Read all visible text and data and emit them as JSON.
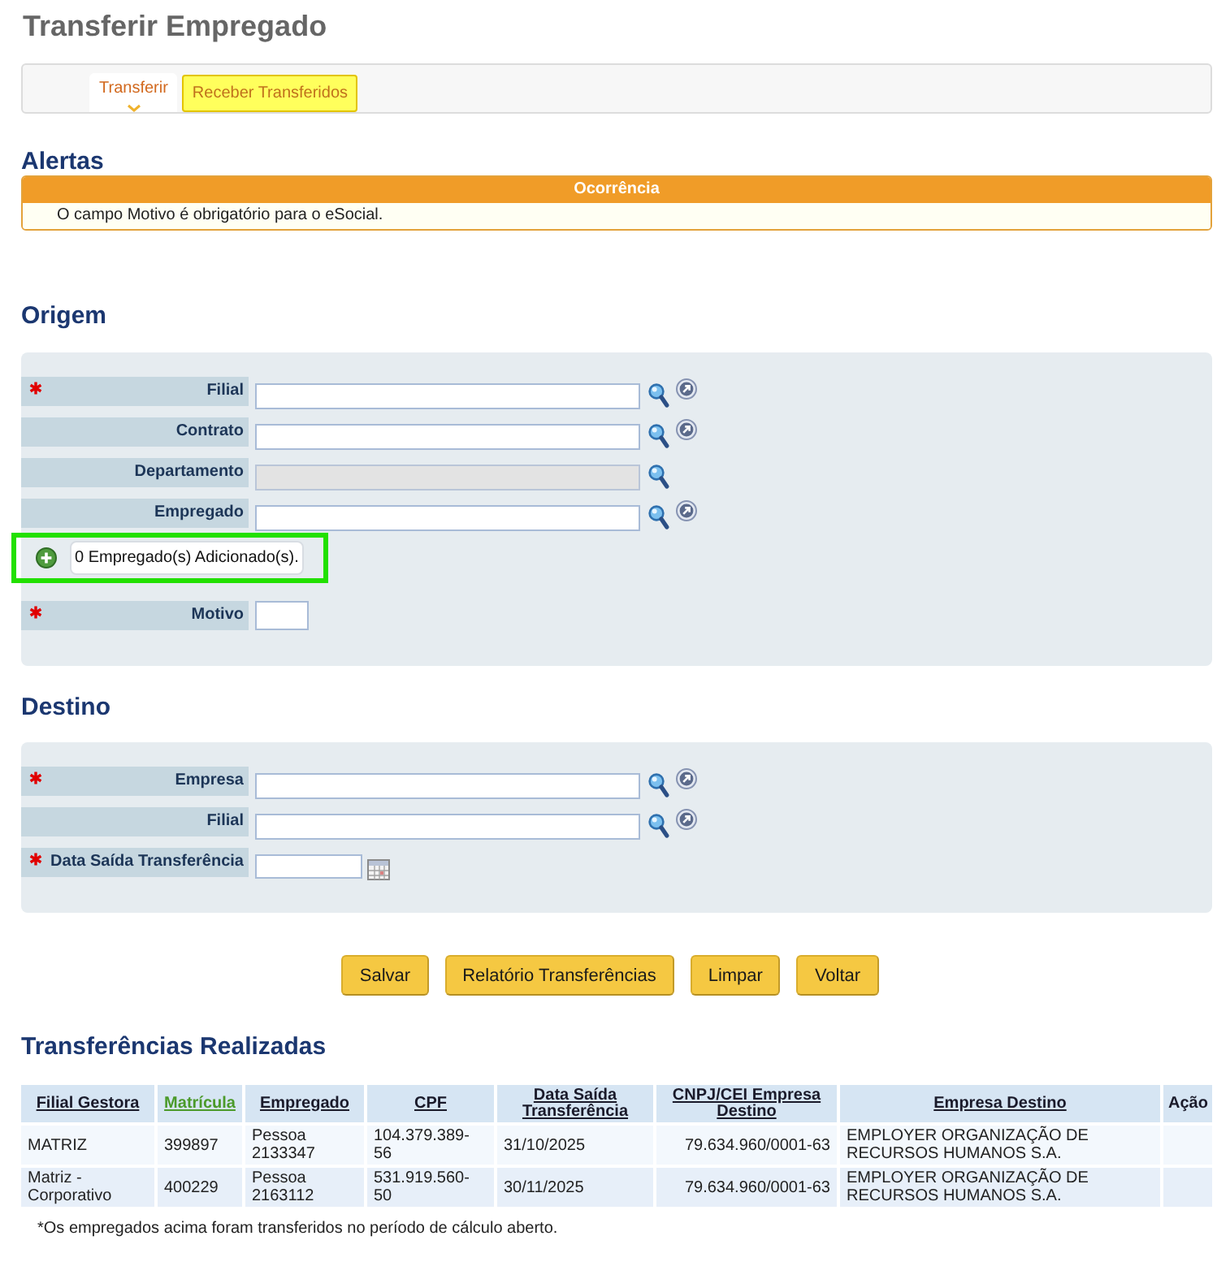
{
  "page_title": "Transferir Empregado",
  "tabs": [
    {
      "label": "Transferir",
      "selected": true
    },
    {
      "label": "Receber Transferidos",
      "selected": false
    }
  ],
  "alerts": {
    "title": "Alertas",
    "header": "Ocorrência",
    "messages": [
      "O campo Motivo é obrigatório para o eSocial."
    ]
  },
  "origin": {
    "title": "Origem",
    "fields": [
      {
        "kind": "lookup",
        "label": "Filial",
        "required": true,
        "disabled": false,
        "open_link": true
      },
      {
        "kind": "lookup",
        "label": "Contrato",
        "required": false,
        "disabled": false,
        "open_link": true
      },
      {
        "kind": "lookup",
        "label": "Departamento",
        "required": false,
        "disabled": true,
        "open_link": false
      },
      {
        "kind": "lookup",
        "label": "Empregado",
        "required": false,
        "disabled": false,
        "open_link": true
      },
      {
        "kind": "added_list",
        "text": "0 Empregado(s) Adicionado(s).",
        "highlighted": true
      },
      {
        "kind": "short",
        "label": "Motivo",
        "required": true,
        "disabled": false
      }
    ]
  },
  "destination": {
    "title": "Destino",
    "fields": [
      {
        "kind": "lookup",
        "label": "Empresa",
        "required": true,
        "disabled": false,
        "open_link": true
      },
      {
        "kind": "lookup",
        "label": "Filial",
        "required": false,
        "disabled": false,
        "open_link": true
      },
      {
        "kind": "date",
        "label": "Data Saída Transferência",
        "required": true,
        "disabled": false
      }
    ]
  },
  "buttons": [
    "Salvar",
    "Relatório Transferências",
    "Limpar",
    "Voltar"
  ],
  "transfers": {
    "title": "Transferências Realizadas",
    "columns": [
      {
        "label": "Filial Gestora",
        "sortable": true,
        "sorted": false
      },
      {
        "label": "Matrícula",
        "sortable": true,
        "sorted": true
      },
      {
        "label": "Empregado",
        "sortable": true,
        "sorted": false
      },
      {
        "label": "CPF",
        "sortable": true,
        "sorted": false
      },
      {
        "label": "Data Saída Transferência",
        "sortable": true,
        "sorted": false
      },
      {
        "label": "CNPJ/CEI Empresa Destino",
        "sortable": true,
        "sorted": false
      },
      {
        "label": "Empresa Destino",
        "sortable": true,
        "sorted": false
      },
      {
        "label": "Ação",
        "sortable": false,
        "sorted": false
      }
    ],
    "rows": [
      {
        "cells": [
          "MATRIZ",
          "399897",
          "Pessoa 2133347",
          "104.379.389-56",
          "31/10/2025",
          "79.634.960/0001-63",
          "EMPLOYER ORGANIZAÇÃO DE RECURSOS HUMANOS S.A."
        ]
      },
      {
        "cells": [
          "Matriz - Corporativo",
          "400229",
          "Pessoa 2163112",
          "531.919.560-50",
          "30/11/2025",
          "79.634.960/0001-63",
          "EMPLOYER ORGANIZAÇÃO DE RECURSOS HUMANOS S.A."
        ]
      }
    ],
    "footnote": "*Os empregados acima foram transferidos no período de cálculo aberto."
  }
}
